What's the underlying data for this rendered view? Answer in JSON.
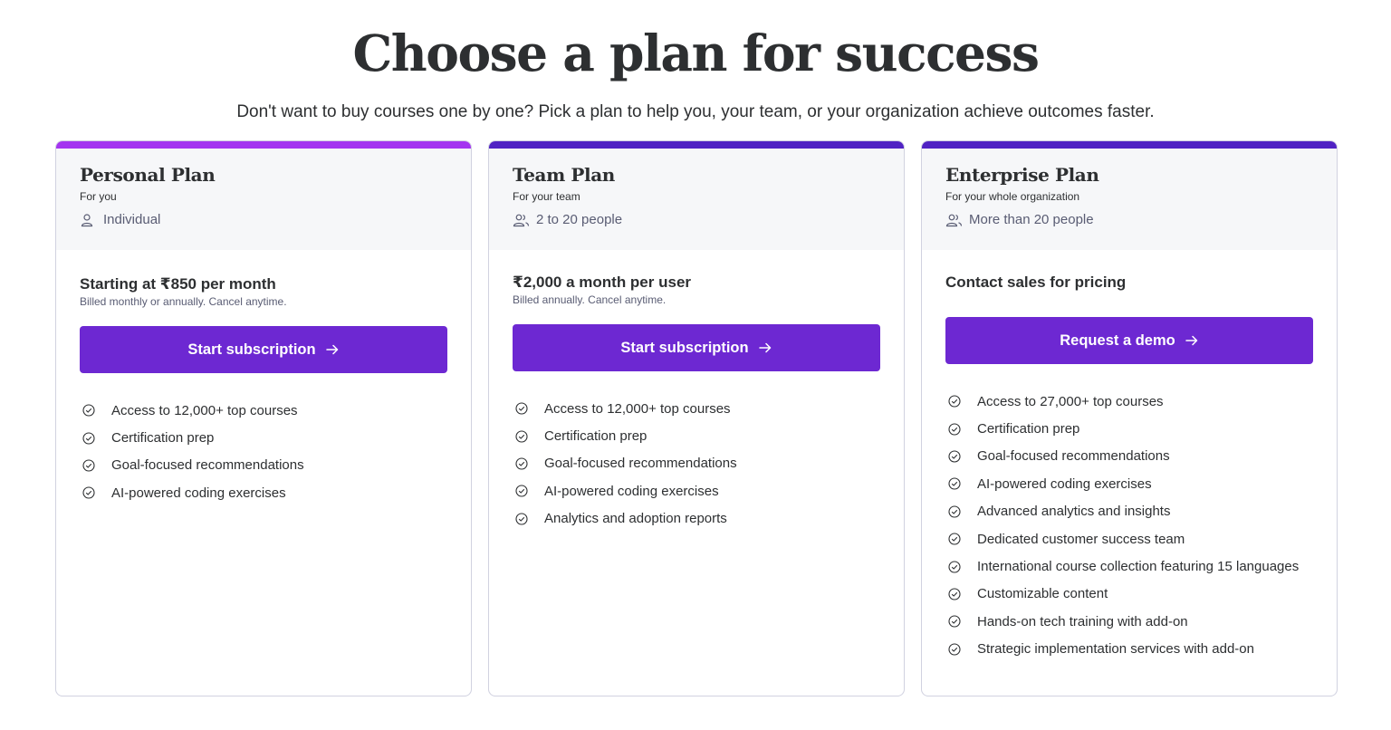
{
  "page": {
    "title": "Choose a plan for success",
    "subtitle": "Don't want to buy courses one by one? Pick a plan to help you, your team, or your organization achieve outcomes faster."
  },
  "colors": {
    "personal_accent": "#a435f0",
    "team_accent": "#5022c3",
    "enterprise_accent": "#5022c3",
    "button": "#6d28d2"
  },
  "plans": [
    {
      "name": "Personal Plan",
      "audience": "For you",
      "size_icon": "person-icon",
      "size": "Individual",
      "price": "Starting at ₹850 per month",
      "price_note": "Billed monthly or annually. Cancel anytime.",
      "cta": "Start subscription",
      "features": [
        "Access to 12,000+ top courses",
        "Certification prep",
        "Goal-focused recommendations",
        "AI-powered coding exercises"
      ]
    },
    {
      "name": "Team Plan",
      "audience": "For your team",
      "size_icon": "people-icon",
      "size": "2 to 20 people",
      "price": "₹2,000 a month per user",
      "price_note": "Billed annually. Cancel anytime.",
      "cta": "Start subscription",
      "features": [
        "Access to 12,000+ top courses",
        "Certification prep",
        "Goal-focused recommendations",
        "AI-powered coding exercises",
        "Analytics and adoption reports"
      ]
    },
    {
      "name": "Enterprise Plan",
      "audience": "For your whole organization",
      "size_icon": "people-icon",
      "size": "More than 20 people",
      "price": "Contact sales for pricing",
      "price_note": "",
      "cta": "Request a demo",
      "features": [
        "Access to 27,000+ top courses",
        "Certification prep",
        "Goal-focused recommendations",
        "AI-powered coding exercises",
        "Advanced analytics and insights",
        "Dedicated customer success team",
        "International course collection featuring 15 languages",
        "Customizable content",
        "Hands-on tech training with add-on",
        "Strategic implementation services with add-on"
      ]
    }
  ]
}
